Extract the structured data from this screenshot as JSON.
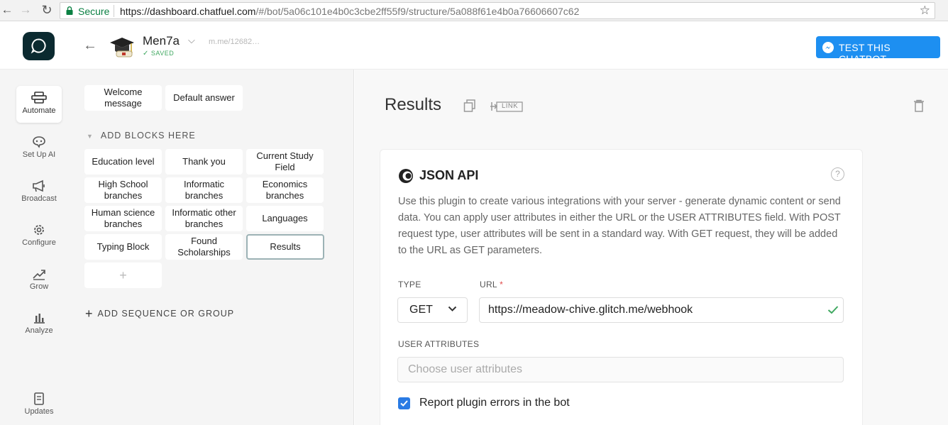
{
  "browser": {
    "secure_label": "Secure",
    "url_host": "https://dashboard.chatfuel.com",
    "url_path": "/#/bot/5a06c101e4b0c3cbe2ff55f9/structure/5a088f61e4b0a76606607c62"
  },
  "header": {
    "bot_name": "Men7a",
    "saved_label": "SAVED",
    "m_link": "m.me/12682…",
    "test_button_label": "TEST THIS CHATBOT"
  },
  "leftnav": {
    "items": [
      {
        "label": "Automate",
        "icon": "automate-icon"
      },
      {
        "label": "Set Up AI",
        "icon": "ai-icon"
      },
      {
        "label": "Broadcast",
        "icon": "megaphone-icon"
      },
      {
        "label": "Configure",
        "icon": "gear-icon"
      },
      {
        "label": "Grow",
        "icon": "trend-icon"
      },
      {
        "label": "Analyze",
        "icon": "bar-chart-icon"
      },
      {
        "label": "Updates",
        "icon": "updates-icon"
      }
    ]
  },
  "blocks": {
    "welcome": "Welcome message",
    "default_answer": "Default answer",
    "section_title": "ADD BLOCKS HERE",
    "items": [
      "Education level",
      "Thank you",
      "Current Study Field",
      "High School branches",
      "Informatic branches",
      "Economics branches",
      "Human science branches",
      "Informatic other branches",
      "Languages",
      "Typing Block",
      "Found Scholarships",
      "Results"
    ],
    "add_symbol": "+",
    "add_sequence_label": "ADD SEQUENCE OR GROUP"
  },
  "editor": {
    "block_title": "Results",
    "link_label": "LINK",
    "plugin": {
      "title": "JSON API",
      "help": "?",
      "description": "Use this plugin to create various integrations with your server - generate dynamic content or send data. You can apply user attributes in either the URL or the USER ATTRIBUTES field. With POST request type, user attributes will be sent in a standard way. With GET request, they will be added to the URL as GET parameters.",
      "type_label": "TYPE",
      "type_value": "GET",
      "url_label": "URL",
      "url_required": "*",
      "url_value": "https://meadow-chive.glitch.me/webhook",
      "attributes_label": "USER ATTRIBUTES",
      "attributes_placeholder": "Choose user attributes",
      "report_errors_label": "Report plugin errors in the bot",
      "report_errors_checked": true
    }
  },
  "colors": {
    "accent": "#1d8ff1",
    "logo_bg": "#0b2a30",
    "saved": "#3fa860",
    "checkbox": "#2a7be4"
  }
}
